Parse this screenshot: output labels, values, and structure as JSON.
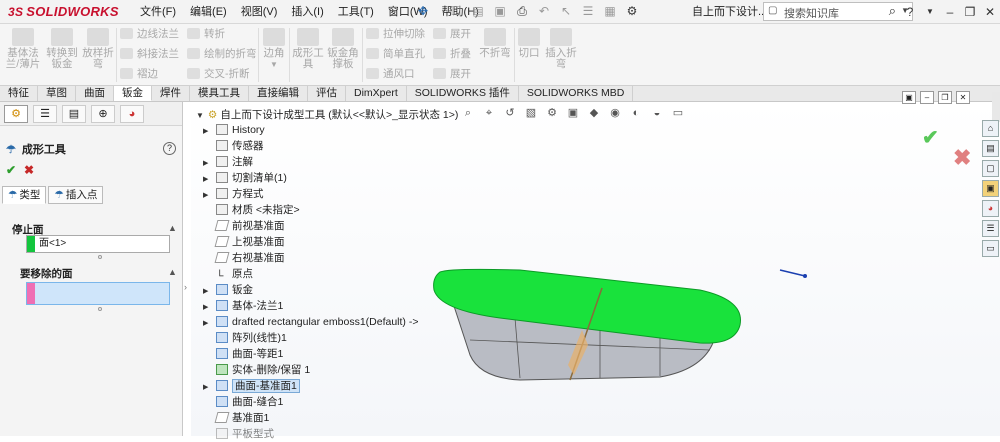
{
  "app": {
    "brand": "SOLIDWORKS",
    "brand_mark": "3S"
  },
  "menu": [
    "文件(F)",
    "编辑(E)",
    "视图(V)",
    "插入(I)",
    "工具(T)",
    "窗口(W)",
    "帮助(H)"
  ],
  "window": {
    "doc_title": "自上而下设计...",
    "search_placeholder": "搜索知识库"
  },
  "ribbon": {
    "big_buttons": [
      {
        "label_1": "基体法",
        "label_2": "兰/薄片"
      },
      {
        "label_1": "转换到",
        "label_2": "钣金"
      },
      {
        "label_1": "放样折",
        "label_2": "弯"
      },
      {
        "label_1": "边角",
        "label_2": ""
      },
      {
        "label_1": "成形工",
        "label_2": "具"
      },
      {
        "label_1": "钣金角",
        "label_2": "撑板"
      },
      {
        "label_1": "不折弯",
        "label_2": ""
      },
      {
        "label_1": "切口",
        "label_2": ""
      },
      {
        "label_1": "插入折",
        "label_2": "弯"
      }
    ],
    "small_buttons": [
      "边线法兰",
      "斜接法兰",
      "褶边",
      "转折",
      "绘制的折弯",
      "交叉-折断",
      "拉伸切除",
      "简单直孔",
      "通风口",
      "展开",
      "折叠",
      "展开"
    ]
  },
  "tabs": [
    "特征",
    "草图",
    "曲面",
    "钣金",
    "焊件",
    "模具工具",
    "直接编辑",
    "评估",
    "DimXpert",
    "SOLIDWORKS 插件",
    "SOLIDWORKS MBD"
  ],
  "property_manager": {
    "title": "成形工具",
    "subtabs": [
      "类型",
      "插入点"
    ],
    "stop_face_header": "停止面",
    "stop_face_value": "面<1>",
    "remove_faces_header": "要移除的面"
  },
  "tree": {
    "root": "自上而下设计成型工具 (默认<<默认>_显示状态 1>)",
    "items": [
      "History",
      "传感器",
      "注解",
      "切割清单(1)",
      "方程式",
      "材质 <未指定>",
      "前视基准面",
      "上视基准面",
      "右视基准面",
      "原点",
      "钣金",
      "基体-法兰1",
      "drafted rectangular emboss1(Default) ->",
      "阵列(线性)1",
      "曲面-等距1",
      "实体-删除/保留 1",
      "曲面-基准面1",
      "曲面-缝合1",
      "基准面1",
      "平板型式"
    ]
  },
  "colors": {
    "brand": "#c8102e",
    "model_top": "#19e23c",
    "model_side": "#b9bcc4",
    "selection": "#cfe3f7"
  },
  "icons": [
    "search-icon",
    "help-icon",
    "ok-icon",
    "cancel-icon",
    "pin-icon"
  ]
}
